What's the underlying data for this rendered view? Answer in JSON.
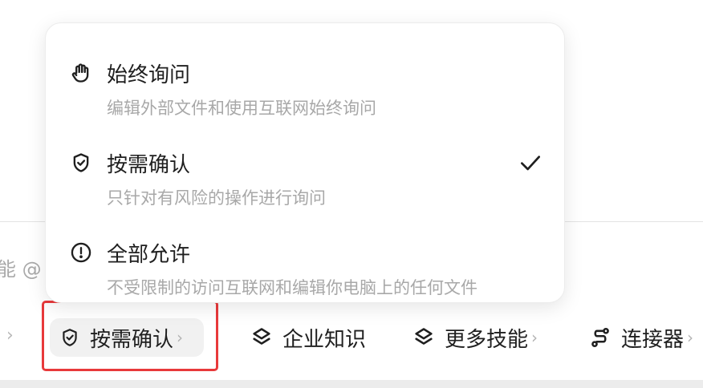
{
  "permission_menu": {
    "options": [
      {
        "title": "始终询问",
        "description": "编辑外部文件和使用互联网始终询问",
        "icon": "hand-icon",
        "selected": false
      },
      {
        "title": "按需确认",
        "description": "只针对有风险的操作进行询问",
        "icon": "shield-check-icon",
        "selected": true
      },
      {
        "title": "全部允许",
        "description": "不受限制的访问互联网和编辑你电脑上的任何文件",
        "icon": "alert-circle-icon",
        "selected": false
      }
    ]
  },
  "input": {
    "placeholder_fragment": "能 @"
  },
  "toolbar": {
    "left_chevron": "›",
    "permission": {
      "label": "按需确认",
      "chevron": "›",
      "icon": "shield-check-icon"
    },
    "knowledge": {
      "label": "企业知识",
      "icon": "layers-icon"
    },
    "skills": {
      "label": "更多技能",
      "chevron": "›",
      "icon": "layers-icon"
    },
    "connector": {
      "label": "连接器",
      "chevron": "›",
      "icon": "connector-icon"
    }
  },
  "colors": {
    "highlight": "#e8393b",
    "text": "#1f1f1f",
    "muted": "#a8a8a8"
  }
}
